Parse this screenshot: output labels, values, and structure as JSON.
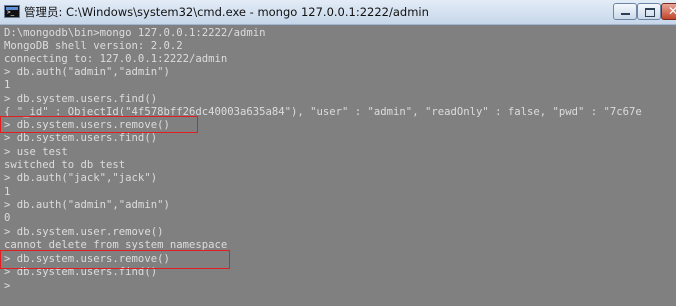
{
  "window": {
    "title": "管理员: C:\\Windows\\system32\\cmd.exe - mongo  127.0.0.1:2222/admin",
    "icon": "cmd-icon",
    "controls": {
      "minimize": "minimize-icon",
      "maximize": "maximize-icon",
      "close": "✕"
    }
  },
  "console": {
    "background": "#808080",
    "text_color": "#dcdcdc",
    "lines": [
      "D:\\mongodb\\bin>mongo 127.0.0.1:2222/admin",
      "MongoDB shell version: 2.0.2",
      "connecting to: 127.0.0.1:2222/admin",
      "> db.auth(\"admin\",\"admin\")",
      "1",
      "> db.system.users.find()",
      "{ \"_id\" : ObjectId(\"4f578bff26dc40003a635a84\"), \"user\" : \"admin\", \"readOnly\" : false, \"pwd\" : \"7c67e",
      "> db.system.users.remove()",
      "> db.system.users.find()",
      "> use test",
      "switched to db test",
      "> db.auth(\"jack\",\"jack\")",
      "1",
      "> db.auth(\"admin\",\"admin\")",
      "0",
      "> db.system.user.remove()",
      "cannot delete from system namespace",
      "> db.system.users.remove()",
      "> db.system.users.find()",
      ">"
    ]
  },
  "annotations": {
    "highlight_color": "#e02020"
  }
}
